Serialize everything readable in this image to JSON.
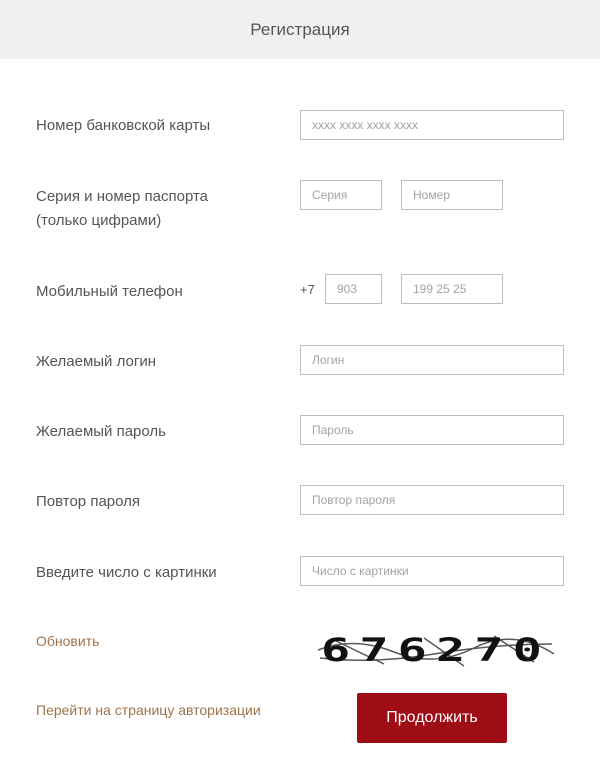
{
  "header": {
    "title": "Регистрация"
  },
  "form": {
    "card": {
      "label": "Номер банковской карты",
      "placeholder": "xxxx xxxx xxxx xxxx"
    },
    "passport": {
      "label_line1": "Серия и номер паспорта",
      "label_line2": "(только цифрами)",
      "series_placeholder": "Серия",
      "number_placeholder": "Номер"
    },
    "phone": {
      "label": "Мобильный телефон",
      "prefix": "+7",
      "code_placeholder": "903",
      "number_placeholder": "199 25 25"
    },
    "login": {
      "label": "Желаемый логин",
      "placeholder": "Логин"
    },
    "password": {
      "label": "Желаемый пароль",
      "placeholder": "Пароль"
    },
    "password_repeat": {
      "label": "Повтор пароля",
      "placeholder": "Повтор пароля"
    },
    "captcha": {
      "label": "Введите число с картинки",
      "placeholder": "Число с картинки",
      "image_text": "676270"
    }
  },
  "links": {
    "refresh": "Обновить",
    "auth": "Перейти на страницу авторизации"
  },
  "buttons": {
    "submit": "Продолжить"
  },
  "colors": {
    "accent": "#9e0d16",
    "link": "#a0724a",
    "header_bg": "#f0f0f0"
  }
}
